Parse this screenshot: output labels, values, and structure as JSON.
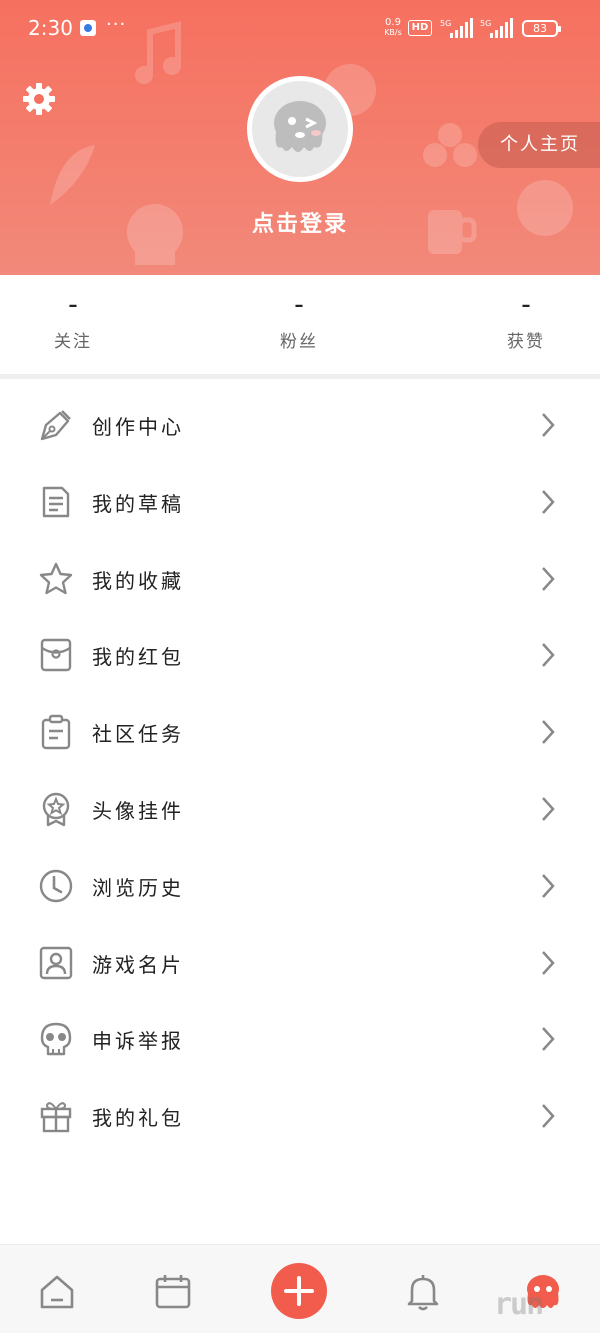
{
  "status_bar": {
    "time": "2:30",
    "dots": "···",
    "net_speed_value": "0.9",
    "net_speed_unit": "KB/s",
    "hd_label": "HD",
    "signal1_label": "5G",
    "signal2_label": "5G",
    "battery": "83"
  },
  "profile": {
    "login_prompt": "点击登录",
    "homepage_button": "个人主页"
  },
  "stats": [
    {
      "value": "–",
      "label": "关注"
    },
    {
      "value": "–",
      "label": "粉丝"
    },
    {
      "value": "–",
      "label": "获赞"
    }
  ],
  "menu": {
    "items": [
      {
        "label": "创作中心",
        "icon": "pen-icon"
      },
      {
        "label": "我的草稿",
        "icon": "document-icon"
      },
      {
        "label": "我的收藏",
        "icon": "star-icon"
      },
      {
        "label": "我的红包",
        "icon": "red-envelope-icon"
      },
      {
        "label": "社区任务",
        "icon": "clipboard-icon"
      },
      {
        "label": "头像挂件",
        "icon": "badge-icon"
      },
      {
        "label": "浏览历史",
        "icon": "clock-icon"
      },
      {
        "label": "游戏名片",
        "icon": "profile-card-icon"
      },
      {
        "label": "申诉举报",
        "icon": "skull-icon"
      },
      {
        "label": "我的礼包",
        "icon": "gift-icon"
      }
    ]
  },
  "bottom_nav": {
    "items": [
      "home-icon",
      "calendar-icon",
      "add-icon",
      "bell-icon",
      "mascot-icon"
    ],
    "watermark": "run"
  },
  "colors": {
    "header_top": "#f6705f",
    "header_bottom": "#f2897a",
    "accent": "#f25c4c",
    "icon_gray": "#888888"
  }
}
